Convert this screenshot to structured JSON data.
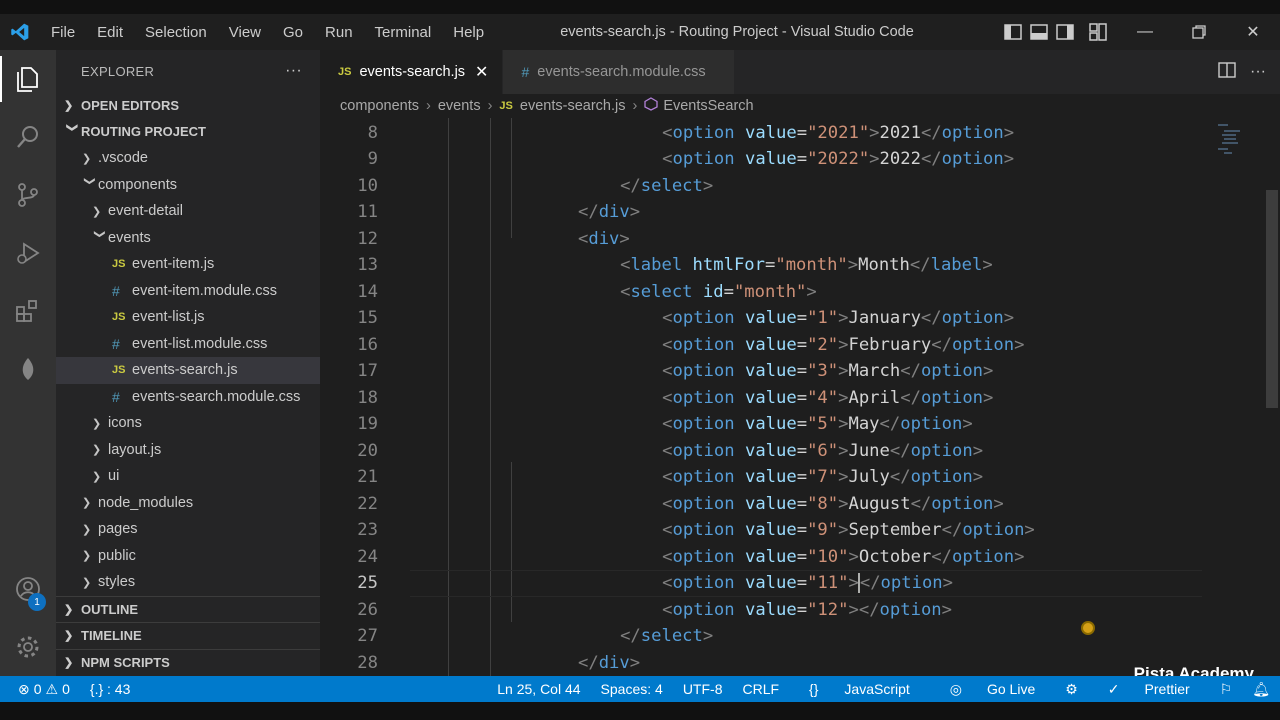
{
  "titlebar": {
    "menu": [
      "File",
      "Edit",
      "Selection",
      "View",
      "Go",
      "Run",
      "Terminal",
      "Help"
    ],
    "window_title": "events-search.js - Routing Project - Visual Studio Code"
  },
  "activitybar": {
    "items": [
      "explorer-icon",
      "search-icon",
      "source-control-icon",
      "run-debug-icon",
      "extensions-icon",
      "leaf-icon"
    ],
    "bottom": [
      "accounts-icon",
      "manage-gear-icon"
    ],
    "accounts_badge": "1"
  },
  "sidebar": {
    "title": "EXPLORER",
    "more": "···",
    "open_editors": "OPEN EDITORS",
    "project": "ROUTING PROJECT",
    "tree": [
      {
        "label": ".vscode",
        "type": "folder",
        "depth": 1,
        "expanded": false
      },
      {
        "label": "components",
        "type": "folder",
        "depth": 1,
        "expanded": true
      },
      {
        "label": "event-detail",
        "type": "folder",
        "depth": 2,
        "expanded": false
      },
      {
        "label": "events",
        "type": "folder",
        "depth": 2,
        "expanded": true
      },
      {
        "label": "event-item.js",
        "type": "js",
        "depth": 3
      },
      {
        "label": "event-item.module.css",
        "type": "css",
        "depth": 3
      },
      {
        "label": "event-list.js",
        "type": "js",
        "depth": 3
      },
      {
        "label": "event-list.module.css",
        "type": "css",
        "depth": 3
      },
      {
        "label": "events-search.js",
        "type": "js",
        "depth": 3,
        "selected": true
      },
      {
        "label": "events-search.module.css",
        "type": "css",
        "depth": 3
      },
      {
        "label": "icons",
        "type": "folder",
        "depth": 2,
        "expanded": false
      },
      {
        "label": "layout.js",
        "type": "folder",
        "depth": 2,
        "expanded": false
      },
      {
        "label": "ui",
        "type": "folder",
        "depth": 2,
        "expanded": false
      },
      {
        "label": "node_modules",
        "type": "folder",
        "depth": 1,
        "expanded": false
      },
      {
        "label": "pages",
        "type": "folder",
        "depth": 1,
        "expanded": false
      },
      {
        "label": "public",
        "type": "folder",
        "depth": 1,
        "expanded": false
      },
      {
        "label": "styles",
        "type": "folder",
        "depth": 1,
        "expanded": false
      }
    ],
    "outline": "OUTLINE",
    "timeline": "TIMELINE",
    "npm_scripts": "NPM SCRIPTS"
  },
  "tabs": [
    {
      "label": "events-search.js",
      "icon": "JS",
      "active": true,
      "close": "✕"
    },
    {
      "label": "events-search.module.css",
      "icon": "#",
      "active": false
    }
  ],
  "breadcrumb": {
    "parts": [
      "components",
      "events",
      "events-search.js",
      "EventsSearch"
    ],
    "file_icon": "JS"
  },
  "editor": {
    "current_line": 25,
    "lines": [
      {
        "n": 8,
        "indent": 10,
        "tokens": [
          [
            "tag",
            "<"
          ],
          [
            "name",
            "option"
          ],
          [
            "text",
            " "
          ],
          [
            "attr",
            "value"
          ],
          [
            "text",
            "="
          ],
          [
            "str",
            "\"2021\""
          ],
          [
            "tag",
            ">"
          ],
          [
            "text",
            "2021"
          ],
          [
            "tag",
            "</"
          ],
          [
            "name",
            "option"
          ],
          [
            "tag",
            ">"
          ]
        ]
      },
      {
        "n": 9,
        "indent": 10,
        "tokens": [
          [
            "tag",
            "<"
          ],
          [
            "name",
            "option"
          ],
          [
            "text",
            " "
          ],
          [
            "attr",
            "value"
          ],
          [
            "text",
            "="
          ],
          [
            "str",
            "\"2022\""
          ],
          [
            "tag",
            ">"
          ],
          [
            "text",
            "2022"
          ],
          [
            "tag",
            "</"
          ],
          [
            "name",
            "option"
          ],
          [
            "tag",
            ">"
          ]
        ]
      },
      {
        "n": 10,
        "indent": 8,
        "tokens": [
          [
            "tag",
            "</"
          ],
          [
            "name",
            "select"
          ],
          [
            "tag",
            ">"
          ]
        ]
      },
      {
        "n": 11,
        "indent": 6,
        "tokens": [
          [
            "tag",
            "</"
          ],
          [
            "name",
            "div"
          ],
          [
            "tag",
            ">"
          ]
        ]
      },
      {
        "n": 12,
        "indent": 6,
        "tokens": [
          [
            "tag",
            "<"
          ],
          [
            "name",
            "div"
          ],
          [
            "tag",
            ">"
          ]
        ]
      },
      {
        "n": 13,
        "indent": 8,
        "tokens": [
          [
            "tag",
            "<"
          ],
          [
            "name",
            "label"
          ],
          [
            "text",
            " "
          ],
          [
            "attr",
            "htmlFor"
          ],
          [
            "text",
            "="
          ],
          [
            "str",
            "\"month\""
          ],
          [
            "tag",
            ">"
          ],
          [
            "text",
            "Month"
          ],
          [
            "tag",
            "</"
          ],
          [
            "name",
            "label"
          ],
          [
            "tag",
            ">"
          ]
        ]
      },
      {
        "n": 14,
        "indent": 8,
        "tokens": [
          [
            "tag",
            "<"
          ],
          [
            "name",
            "select"
          ],
          [
            "text",
            " "
          ],
          [
            "attr",
            "id"
          ],
          [
            "text",
            "="
          ],
          [
            "str",
            "\"month\""
          ],
          [
            "tag",
            ">"
          ]
        ]
      },
      {
        "n": 15,
        "indent": 10,
        "tokens": [
          [
            "tag",
            "<"
          ],
          [
            "name",
            "option"
          ],
          [
            "text",
            " "
          ],
          [
            "attr",
            "value"
          ],
          [
            "text",
            "="
          ],
          [
            "str",
            "\"1\""
          ],
          [
            "tag",
            ">"
          ],
          [
            "text",
            "January"
          ],
          [
            "tag",
            "</"
          ],
          [
            "name",
            "option"
          ],
          [
            "tag",
            ">"
          ]
        ]
      },
      {
        "n": 16,
        "indent": 10,
        "tokens": [
          [
            "tag",
            "<"
          ],
          [
            "name",
            "option"
          ],
          [
            "text",
            " "
          ],
          [
            "attr",
            "value"
          ],
          [
            "text",
            "="
          ],
          [
            "str",
            "\"2\""
          ],
          [
            "tag",
            ">"
          ],
          [
            "text",
            "February"
          ],
          [
            "tag",
            "</"
          ],
          [
            "name",
            "option"
          ],
          [
            "tag",
            ">"
          ]
        ]
      },
      {
        "n": 17,
        "indent": 10,
        "tokens": [
          [
            "tag",
            "<"
          ],
          [
            "name",
            "option"
          ],
          [
            "text",
            " "
          ],
          [
            "attr",
            "value"
          ],
          [
            "text",
            "="
          ],
          [
            "str",
            "\"3\""
          ],
          [
            "tag",
            ">"
          ],
          [
            "text",
            "March"
          ],
          [
            "tag",
            "</"
          ],
          [
            "name",
            "option"
          ],
          [
            "tag",
            ">"
          ]
        ]
      },
      {
        "n": 18,
        "indent": 10,
        "tokens": [
          [
            "tag",
            "<"
          ],
          [
            "name",
            "option"
          ],
          [
            "text",
            " "
          ],
          [
            "attr",
            "value"
          ],
          [
            "text",
            "="
          ],
          [
            "str",
            "\"4\""
          ],
          [
            "tag",
            ">"
          ],
          [
            "text",
            "April"
          ],
          [
            "tag",
            "</"
          ],
          [
            "name",
            "option"
          ],
          [
            "tag",
            ">"
          ]
        ]
      },
      {
        "n": 19,
        "indent": 10,
        "tokens": [
          [
            "tag",
            "<"
          ],
          [
            "name",
            "option"
          ],
          [
            "text",
            " "
          ],
          [
            "attr",
            "value"
          ],
          [
            "text",
            "="
          ],
          [
            "str",
            "\"5\""
          ],
          [
            "tag",
            ">"
          ],
          [
            "text",
            "May"
          ],
          [
            "tag",
            "</"
          ],
          [
            "name",
            "option"
          ],
          [
            "tag",
            ">"
          ]
        ]
      },
      {
        "n": 20,
        "indent": 10,
        "tokens": [
          [
            "tag",
            "<"
          ],
          [
            "name",
            "option"
          ],
          [
            "text",
            " "
          ],
          [
            "attr",
            "value"
          ],
          [
            "text",
            "="
          ],
          [
            "str",
            "\"6\""
          ],
          [
            "tag",
            ">"
          ],
          [
            "text",
            "June"
          ],
          [
            "tag",
            "</"
          ],
          [
            "name",
            "option"
          ],
          [
            "tag",
            ">"
          ]
        ]
      },
      {
        "n": 21,
        "indent": 10,
        "tokens": [
          [
            "tag",
            "<"
          ],
          [
            "name",
            "option"
          ],
          [
            "text",
            " "
          ],
          [
            "attr",
            "value"
          ],
          [
            "text",
            "="
          ],
          [
            "str",
            "\"7\""
          ],
          [
            "tag",
            ">"
          ],
          [
            "text",
            "July"
          ],
          [
            "tag",
            "</"
          ],
          [
            "name",
            "option"
          ],
          [
            "tag",
            ">"
          ]
        ]
      },
      {
        "n": 22,
        "indent": 10,
        "tokens": [
          [
            "tag",
            "<"
          ],
          [
            "name",
            "option"
          ],
          [
            "text",
            " "
          ],
          [
            "attr",
            "value"
          ],
          [
            "text",
            "="
          ],
          [
            "str",
            "\"8\""
          ],
          [
            "tag",
            ">"
          ],
          [
            "text",
            "August"
          ],
          [
            "tag",
            "</"
          ],
          [
            "name",
            "option"
          ],
          [
            "tag",
            ">"
          ]
        ]
      },
      {
        "n": 23,
        "indent": 10,
        "tokens": [
          [
            "tag",
            "<"
          ],
          [
            "name",
            "option"
          ],
          [
            "text",
            " "
          ],
          [
            "attr",
            "value"
          ],
          [
            "text",
            "="
          ],
          [
            "str",
            "\"9\""
          ],
          [
            "tag",
            ">"
          ],
          [
            "text",
            "September"
          ],
          [
            "tag",
            "</"
          ],
          [
            "name",
            "option"
          ],
          [
            "tag",
            ">"
          ]
        ]
      },
      {
        "n": 24,
        "indent": 10,
        "tokens": [
          [
            "tag",
            "<"
          ],
          [
            "name",
            "option"
          ],
          [
            "text",
            " "
          ],
          [
            "attr",
            "value"
          ],
          [
            "text",
            "="
          ],
          [
            "str",
            "\"10\""
          ],
          [
            "tag",
            ">"
          ],
          [
            "text",
            "October"
          ],
          [
            "tag",
            "</"
          ],
          [
            "name",
            "option"
          ],
          [
            "tag",
            ">"
          ]
        ]
      },
      {
        "n": 25,
        "indent": 10,
        "caret_after": 7,
        "tokens": [
          [
            "tag",
            "<"
          ],
          [
            "name",
            "option"
          ],
          [
            "text",
            " "
          ],
          [
            "attr",
            "value"
          ],
          [
            "text",
            "="
          ],
          [
            "str",
            "\"11\""
          ],
          [
            "tag",
            ">"
          ],
          [
            "tag",
            "</"
          ],
          [
            "name",
            "option"
          ],
          [
            "tag",
            ">"
          ]
        ]
      },
      {
        "n": 26,
        "indent": 10,
        "tokens": [
          [
            "tag",
            "<"
          ],
          [
            "name",
            "option"
          ],
          [
            "text",
            " "
          ],
          [
            "attr",
            "value"
          ],
          [
            "text",
            "="
          ],
          [
            "str",
            "\"12\""
          ],
          [
            "tag",
            ">"
          ],
          [
            "tag",
            "</"
          ],
          [
            "name",
            "option"
          ],
          [
            "tag",
            ">"
          ]
        ]
      },
      {
        "n": 27,
        "indent": 8,
        "tokens": [
          [
            "tag",
            "</"
          ],
          [
            "name",
            "select"
          ],
          [
            "tag",
            ">"
          ]
        ]
      },
      {
        "n": 28,
        "indent": 6,
        "tokens": [
          [
            "tag",
            "</"
          ],
          [
            "name",
            "div"
          ],
          [
            "tag",
            ">"
          ]
        ]
      }
    ]
  },
  "watermark": "Pista Academy",
  "statusbar": {
    "errors": "0",
    "warnings": "0",
    "bracket_info": "{.} : 43",
    "position": "Ln 25, Col 44",
    "spaces": "Spaces: 4",
    "encoding": "UTF-8",
    "eol": "CRLF",
    "language": "JavaScript",
    "language_icon": "{}",
    "go_live": "Go Live",
    "prettier": "Prettier"
  },
  "colors": {
    "accent": "#007acc",
    "tag": "#808080",
    "tag_name": "#569cd6",
    "attr": "#9cdcfe",
    "string": "#ce9178",
    "text": "#d4d4d4",
    "js_icon": "#cbcb41",
    "css_icon": "#519aba"
  }
}
